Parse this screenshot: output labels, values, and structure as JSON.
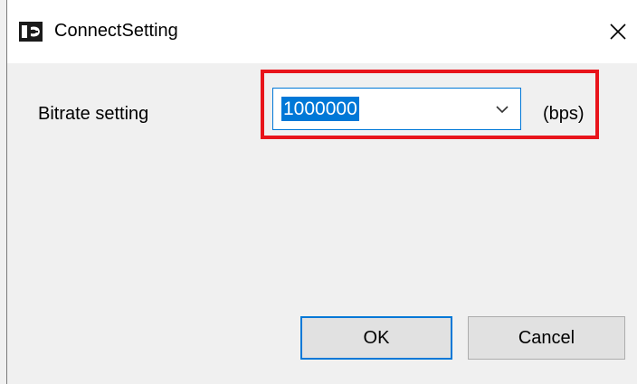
{
  "window": {
    "title": "ConnectSetting",
    "close_label": "X"
  },
  "form": {
    "bitrate_label": "Bitrate setting",
    "bitrate_value": "1000000",
    "unit_label": "(bps)"
  },
  "buttons": {
    "ok_label": "OK",
    "cancel_label": "Cancel"
  },
  "icons": {
    "app": "app-logo-icon",
    "close": "close-icon",
    "dropdown": "chevron-down-icon"
  },
  "colors": {
    "highlight": "#e8141b",
    "accent": "#0078d7",
    "background": "#f0f0f0"
  }
}
